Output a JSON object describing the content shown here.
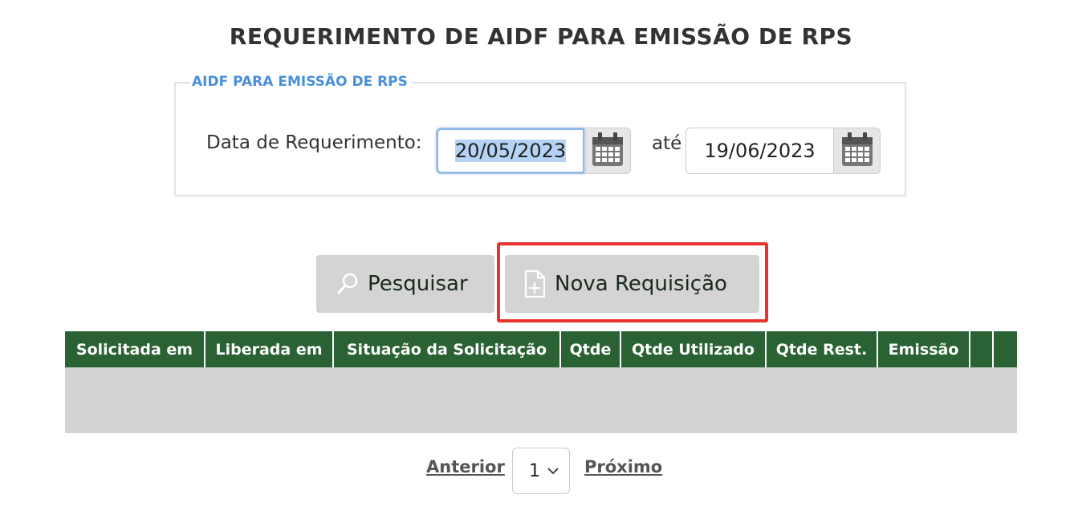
{
  "page": {
    "title": "REQUERIMENTO DE AIDF PARA EMISSÃO DE RPS"
  },
  "filter": {
    "legend": "AIDF PARA EMISSÃO DE RPS",
    "date_label": "Data de Requerimento:",
    "start_date": "20/05/2023",
    "separator_label": "até",
    "end_date": "19/06/2023"
  },
  "actions": {
    "search_label": "Pesquisar",
    "new_request_label": "Nova Requisição"
  },
  "table": {
    "columns": [
      "Solicitada em",
      "Liberada em",
      "Situação da Solicitação",
      "Qtde",
      "Qtde Utilizado",
      "Qtde Rest.",
      "Emissão",
      "",
      ""
    ],
    "rows": []
  },
  "pagination": {
    "prev_label": "Anterior",
    "current_page": "1",
    "next_label": "Próximo"
  },
  "colors": {
    "header_green": "#2b6234",
    "legend_blue": "#4a90d9",
    "highlight_red": "#e8322b"
  },
  "icons": {
    "search": "magnifier-icon",
    "new_request": "new-document-icon",
    "calendar": "calendar-icon",
    "dropdown": "chevron-down-icon"
  }
}
